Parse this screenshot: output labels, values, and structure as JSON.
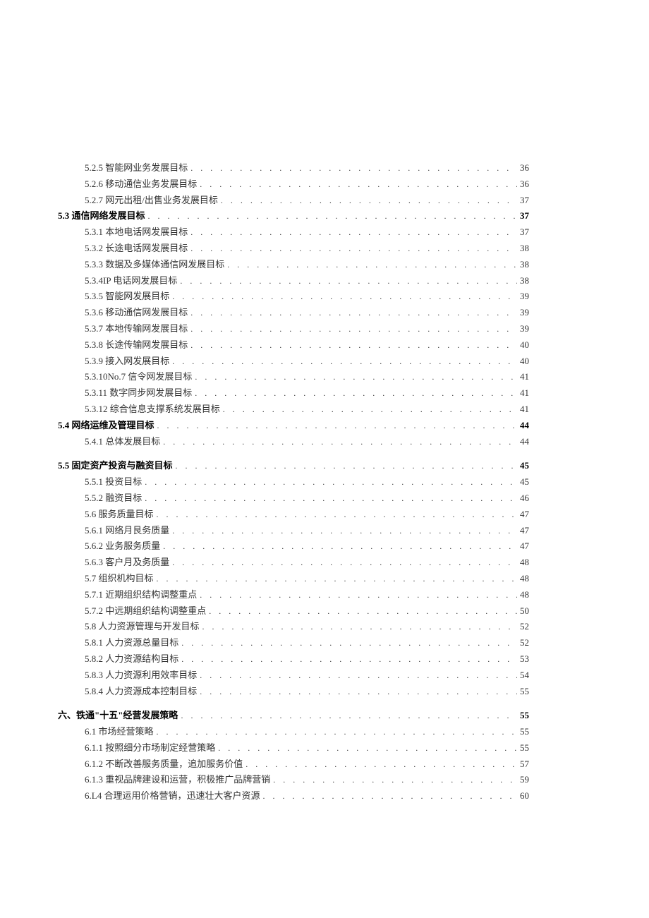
{
  "toc": [
    {
      "indent": 1,
      "bold": false,
      "label": "5.2.5 智能网业务发展目标",
      "page": "36"
    },
    {
      "indent": 1,
      "bold": false,
      "label": "5.2.6 移动通信业务发展目标",
      "page": "36"
    },
    {
      "indent": 1,
      "bold": false,
      "label": "5.2.7 网元出租/出售业务发展目标",
      "page": "37"
    },
    {
      "indent": 0,
      "bold": true,
      "label": "5.3 通信网络发展目标",
      "page": "37"
    },
    {
      "indent": 1,
      "bold": false,
      "label": "5.3.1 本地电话网发展目标",
      "page": "37"
    },
    {
      "indent": 1,
      "bold": false,
      "label": "5.3.2 长途电话网发展目标",
      "page": "38"
    },
    {
      "indent": 1,
      "bold": false,
      "label": "5.3.3 数据及多媒体通信网发展目标",
      "page": "38"
    },
    {
      "indent": 1,
      "bold": false,
      "label": "5.3.4IP 电话网发展目标",
      "page": "38"
    },
    {
      "indent": 1,
      "bold": false,
      "label": "5.3.5 智能网发展目标",
      "page": "39"
    },
    {
      "indent": 1,
      "bold": false,
      "label": "5.3.6 移动通信网发展目标",
      "page": "39"
    },
    {
      "indent": 1,
      "bold": false,
      "label": "5.3.7 本地传输网发展目标",
      "page": "39"
    },
    {
      "indent": 1,
      "bold": false,
      "label": "5.3.8 长途传输网发展目标",
      "page": "40"
    },
    {
      "indent": 1,
      "bold": false,
      "label": "5.3.9 接入网发展目标",
      "page": "40"
    },
    {
      "indent": 1,
      "bold": false,
      "label": "5.3.10No.7 信令网发展目标",
      "page": "41"
    },
    {
      "indent": 1,
      "bold": false,
      "label": "5.3.11 数字同步网发展目标",
      "page": "41"
    },
    {
      "indent": 1,
      "bold": false,
      "label": "5.3.12 综合信息支撑系统发展目标",
      "page": "41"
    },
    {
      "indent": 0,
      "bold": true,
      "label": "5.4 网络运维及管理目标",
      "page": "44"
    },
    {
      "indent": 1,
      "bold": false,
      "label": "5.4.1 总体发展目标",
      "page": "44",
      "gapAfter": true
    },
    {
      "indent": 0,
      "bold": true,
      "label": "5.5 固定资产投资与融资目标",
      "page": "45"
    },
    {
      "indent": 1,
      "bold": false,
      "label": "5.5.1 投资目标",
      "page": "45"
    },
    {
      "indent": 1,
      "bold": false,
      "label": "5.5.2 融资目标",
      "page": "46"
    },
    {
      "indent": 1,
      "bold": false,
      "label": "5.6 服务质量目标",
      "page": "47"
    },
    {
      "indent": 1,
      "bold": false,
      "label": "5.6.1 网络月艮务质量",
      "page": "47"
    },
    {
      "indent": 1,
      "bold": false,
      "label": "5.6.2 业务服务质量",
      "page": "47"
    },
    {
      "indent": 1,
      "bold": false,
      "label": "5.6.3 客户月及务质量",
      "page": "48"
    },
    {
      "indent": 1,
      "bold": false,
      "label": "5.7 组织机构目标",
      "page": "48"
    },
    {
      "indent": 1,
      "bold": false,
      "label": "5.7.1 近期组织结构调整重点",
      "page": "48"
    },
    {
      "indent": 1,
      "bold": false,
      "label": "5.7.2 中远期组织结构调整重点",
      "page": "50"
    },
    {
      "indent": 1,
      "bold": false,
      "label": "5.8 人力资源管理与开发目标",
      "page": "52"
    },
    {
      "indent": 1,
      "bold": false,
      "label": "5.8.1 人力资源总量目标",
      "page": "52"
    },
    {
      "indent": 1,
      "bold": false,
      "label": "5.8.2 人力资源结构目标",
      "page": "53"
    },
    {
      "indent": 1,
      "bold": false,
      "label": "5.8.3 人力资源利用效率目标",
      "page": "54"
    },
    {
      "indent": 1,
      "bold": false,
      "label": "5.8.4 人力资源成本控制目标",
      "page": "55",
      "gapAfter": true
    },
    {
      "indent": 0,
      "bold": true,
      "label": "六、铁通\"十五\"经营发展策略",
      "page": "55"
    },
    {
      "indent": 1,
      "bold": false,
      "label": "6.1 市场经营策略",
      "page": "55"
    },
    {
      "indent": 1,
      "bold": false,
      "label": "6.1.1 按照细分市场制定经营策略",
      "page": "55"
    },
    {
      "indent": 1,
      "bold": false,
      "label": "6.1.2 不断改善服务质量，追加服务价值",
      "page": "57"
    },
    {
      "indent": 1,
      "bold": false,
      "label": "6.1.3 重视品牌建设和运营，积极推广品牌营销",
      "page": "59"
    },
    {
      "indent": 1,
      "bold": false,
      "label": "6.L4 合理运用价格营销，迅速壮大客户资源",
      "page": "60"
    }
  ]
}
